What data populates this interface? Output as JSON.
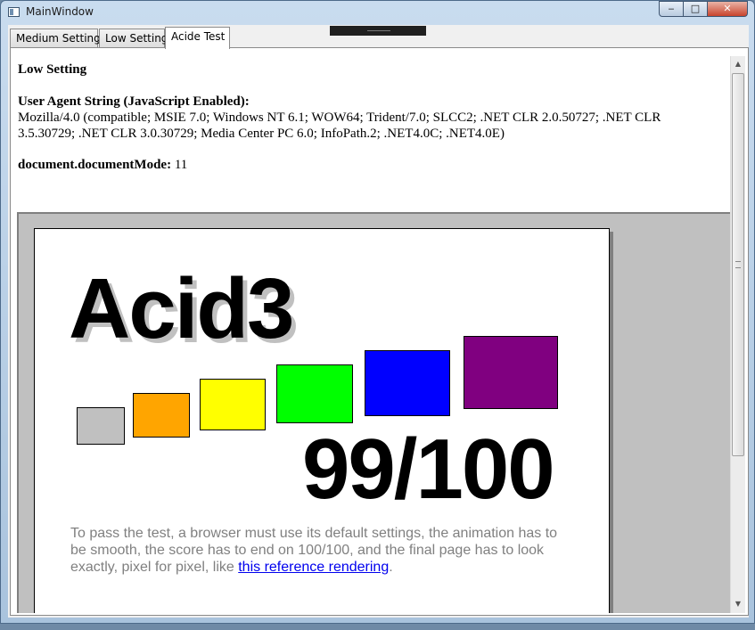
{
  "window": {
    "title": "MainWindow",
    "minimize": "‒",
    "maximize": "□",
    "close": "✕"
  },
  "tabs": [
    {
      "label": "Medium Setting"
    },
    {
      "label": "Low Setting"
    },
    {
      "label": "Acide Test",
      "selected": true
    }
  ],
  "page": {
    "heading": "Low Setting",
    "ua_label": "User Agent String (JavaScript Enabled):",
    "ua_line1": "Mozilla/4.0 (compatible; MSIE 7.0; Windows NT 6.1; WOW64; Trident/7.0; SLCC2; .NET CLR 2.0.50727; .NET CLR",
    "ua_line2": "3.5.30729; .NET CLR 3.0.30729; Media Center PC 6.0; InfoPath.2; .NET4.0C; .NET4.0E)",
    "docmode_label": "document.documentMode:",
    "docmode_value": "11"
  },
  "acid": {
    "title": "Acid3",
    "score": "99/100",
    "desc_prefix": "To pass the test, a browser must use its default settings, the animation has to be smooth, the score has to end on 100/100, and the final page has to look exactly, pixel for pixel, like",
    "link_text": "this reference rendering",
    "desc_suffix": ".",
    "bucket_colors": [
      "#c0c0c0",
      "#ffa500",
      "#ffff00",
      "#00ff00",
      "#0000ff",
      "#800080"
    ]
  }
}
